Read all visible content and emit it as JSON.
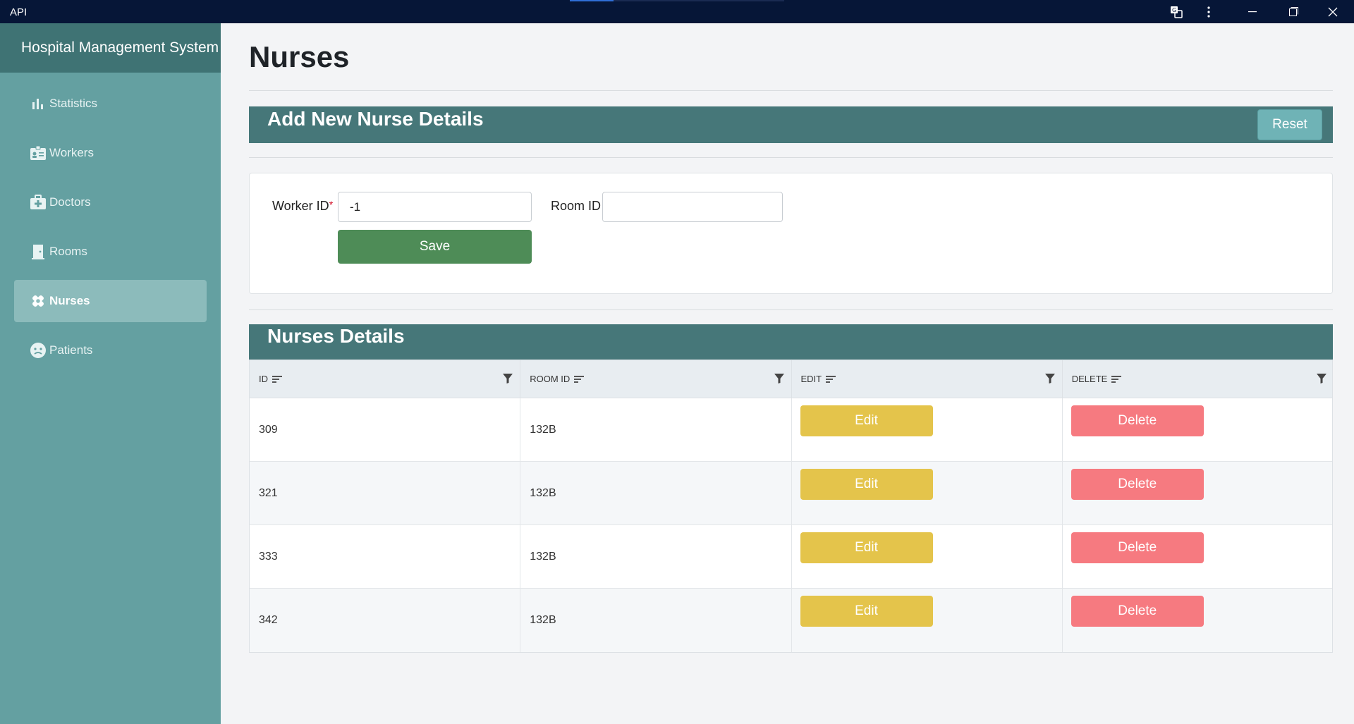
{
  "window": {
    "title": "API"
  },
  "sidebar": {
    "brand": "Hospital Management System",
    "items": [
      {
        "label": "Statistics",
        "icon": "bar-chart-icon"
      },
      {
        "label": "Workers",
        "icon": "id-badge-icon"
      },
      {
        "label": "Doctors",
        "icon": "medical-kit-icon"
      },
      {
        "label": "Rooms",
        "icon": "door-icon"
      },
      {
        "label": "Nurses",
        "icon": "bandage-icon",
        "active": true
      },
      {
        "label": "Patients",
        "icon": "sick-face-icon"
      }
    ]
  },
  "page": {
    "title": "Nurses"
  },
  "form_section": {
    "title": "Add New Nurse Details",
    "reset_label": "Reset",
    "worker_id_label": "Worker ID",
    "required_marker": "*",
    "worker_id_value": "-1",
    "room_id_label": "Room ID",
    "room_id_value": "",
    "save_label": "Save"
  },
  "table_section": {
    "title": "Nurses Details",
    "columns": [
      "ID",
      "ROOM ID",
      "EDIT",
      "DELETE"
    ],
    "edit_label": "Edit",
    "delete_label": "Delete",
    "rows": [
      {
        "id": "309",
        "room_id": "132B"
      },
      {
        "id": "321",
        "room_id": "132B"
      },
      {
        "id": "333",
        "room_id": "132B"
      },
      {
        "id": "342",
        "room_id": "132B"
      }
    ]
  },
  "colors": {
    "titlebar": "#061637",
    "sidebar": "#64a0a1",
    "brand_bar": "#3f7374",
    "section_bar": "#467779",
    "save": "#4e8c57",
    "edit": "#e4c44b",
    "delete": "#f67a80",
    "reset": "#6fb3b6"
  }
}
